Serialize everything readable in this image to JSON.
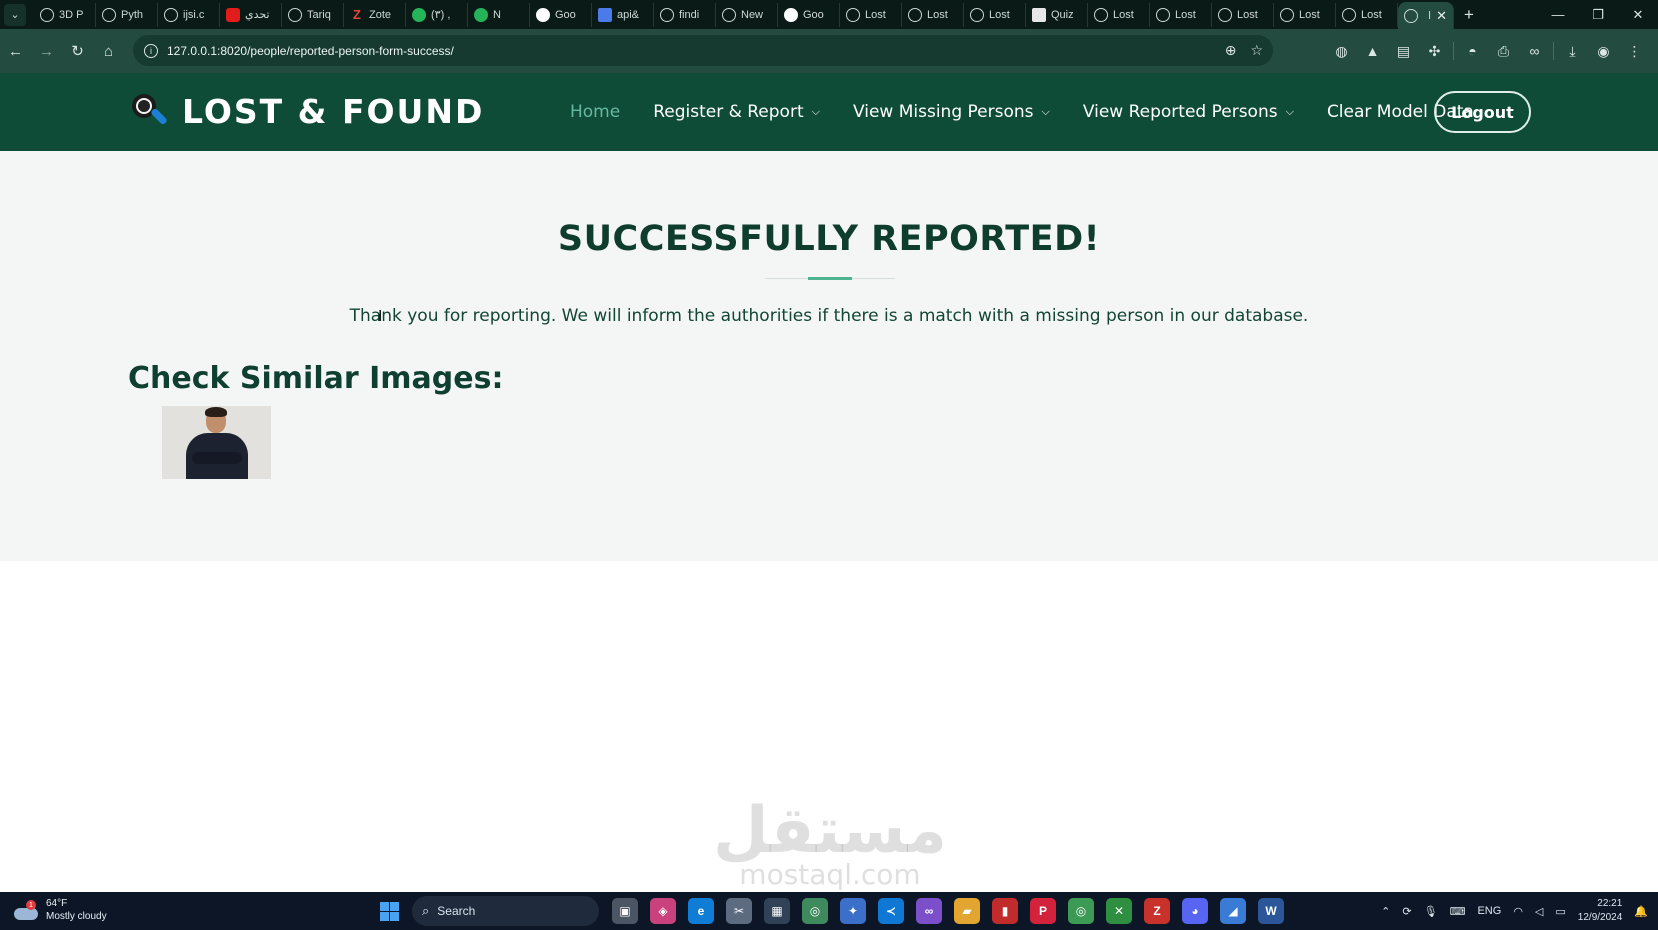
{
  "browser": {
    "tabs": [
      {
        "label": "3D P",
        "icon": "gear-icon"
      },
      {
        "label": "Pyth",
        "icon": "globe-icon"
      },
      {
        "label": "ijsi.c",
        "icon": "globe-icon"
      },
      {
        "label": "تحدي",
        "icon": "youtube-icon"
      },
      {
        "label": "Tariq",
        "icon": "github-icon"
      },
      {
        "label": "Zote",
        "icon": "zotero-icon"
      },
      {
        "label": "(٣) ,",
        "icon": "whatsapp-icon"
      },
      {
        "label": "N",
        "icon": "meet-icon"
      },
      {
        "label": "Goo",
        "icon": "google-icon"
      },
      {
        "label": "api&",
        "icon": "docs-icon"
      },
      {
        "label": "findi",
        "icon": "github-icon"
      },
      {
        "label": "New",
        "icon": "gear-icon"
      },
      {
        "label": "Goo",
        "icon": "google-icon"
      },
      {
        "label": "Lost",
        "icon": "globe-icon"
      },
      {
        "label": "Lost",
        "icon": "globe-icon"
      },
      {
        "label": "Lost",
        "icon": "globe-icon"
      },
      {
        "label": "Quiz",
        "icon": "paper-icon"
      },
      {
        "label": "Lost",
        "icon": "globe-icon"
      },
      {
        "label": "Lost",
        "icon": "globe-icon"
      },
      {
        "label": "Lost",
        "icon": "globe-icon"
      },
      {
        "label": "Lost",
        "icon": "globe-icon"
      },
      {
        "label": "Lost",
        "icon": "globe-icon"
      }
    ],
    "active_tab": {
      "label": "l",
      "close": "✕"
    },
    "new_tab": "+",
    "url": "127.0.0.1:8020/people/reported-person-form-success/"
  },
  "site": {
    "logo_text": "LOST & FOUND",
    "nav": {
      "home": "Home",
      "register_report": "Register & Report",
      "view_missing": "View Missing Persons",
      "view_reported": "View Reported Persons",
      "clear_model": "Clear Model Data"
    },
    "logout": "Logout"
  },
  "main": {
    "title": "SUCCESSFULLY REPORTED!",
    "message": "Thank you for reporting. We will inform the authorities if there is a match with a missing person in our database.",
    "similar_heading": "Check Similar Images:"
  },
  "watermark": {
    "arabic": "مستقل",
    "latin": "mostaql.com"
  },
  "taskbar": {
    "temperature": "64°F",
    "weather": "Mostly cloudy",
    "weather_badge": "1",
    "search_placeholder": "Search",
    "language": "ENG",
    "time": "22:21",
    "date": "12/9/2024"
  },
  "colors": {
    "header_bg": "#0f4c38",
    "accent": "#4cb48f",
    "title": "#0e3d2e",
    "browser_toolbar": "#244b40"
  }
}
